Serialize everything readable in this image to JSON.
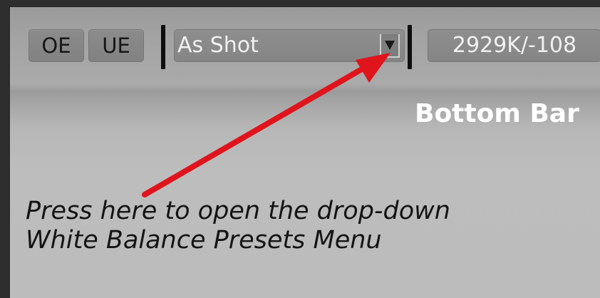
{
  "toolbar": {
    "oe_label": "OE",
    "ue_label": "UE",
    "white_balance": {
      "selected": "As Shot",
      "arrow_icon": "triangle-down-icon"
    },
    "temp_tint": "2929K/-108"
  },
  "annotations": {
    "region_label": "Bottom Bar",
    "instruction_line1": "Press here to open the drop-down",
    "instruction_line2": "White Balance Presets Menu",
    "arrow_color": "#e0141c"
  }
}
